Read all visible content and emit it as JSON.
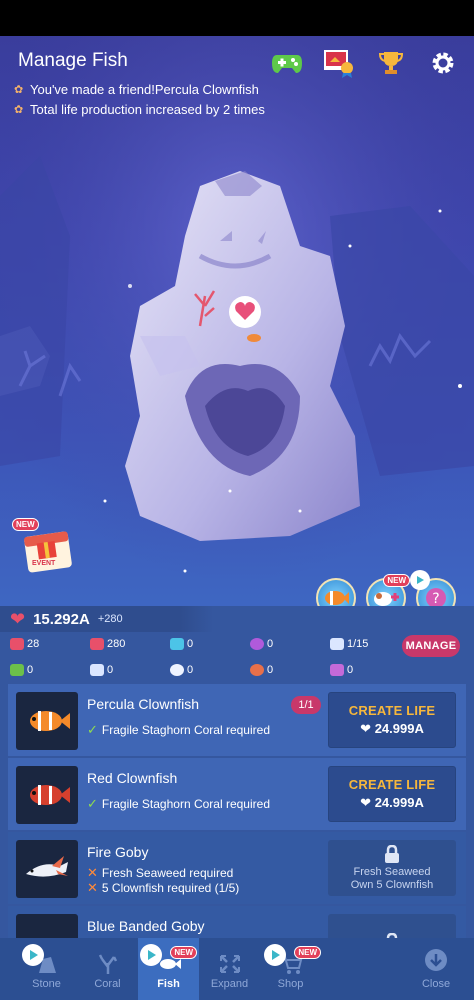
{
  "header": {
    "title": "Manage Fish",
    "messages": [
      "You've made a friend!Percula Clownfish",
      "Total life production increased by 2 times"
    ]
  },
  "icons": {
    "controller": "game-controller-icon",
    "album": "photo-album-icon",
    "trophy": "trophy-icon",
    "settings": "gear-icon"
  },
  "event": {
    "new": "NEW",
    "label": "EVENT"
  },
  "actions": {
    "new": "NEW"
  },
  "life": {
    "value": "15.292A",
    "rate": "+280"
  },
  "stats_row1": [
    {
      "icon": "heart-icon",
      "value": "28"
    },
    {
      "icon": "heart-icon",
      "value": "280"
    },
    {
      "icon": "diamond-icon",
      "value": "0"
    },
    {
      "icon": "pearl-icon",
      "value": "0"
    },
    {
      "icon": "fish-icon",
      "value": "1/15"
    }
  ],
  "manage_label": "MANAGE",
  "stats_row2": [
    {
      "icon": "seaweed-icon",
      "value": "0"
    },
    {
      "icon": "shell-icon",
      "value": "0"
    },
    {
      "icon": "urchin-icon",
      "value": "0"
    },
    {
      "icon": "crab-icon",
      "value": "0"
    },
    {
      "icon": "seahorse-icon",
      "value": "0"
    }
  ],
  "fish": [
    {
      "name": "Percula Clownfish",
      "badge": "1/1",
      "req1": "Fragile Staghorn Coral required",
      "button": "CREATE LIFE",
      "cost": "24.999A"
    },
    {
      "name": "Red Clownfish",
      "req1": "Fragile Staghorn Coral required",
      "button": "CREATE LIFE",
      "cost": "24.999A"
    },
    {
      "name": "Fire Goby",
      "req1": "Fresh Seaweed required",
      "req2": "5 Clownfish required (1/5)",
      "lock1": "Fresh Seaweed",
      "lock2": "Own 5 Clownfish"
    },
    {
      "name": "Blue Banded Goby"
    }
  ],
  "nav": {
    "stone": "Stone",
    "coral": "Coral",
    "fish": "Fish",
    "expand": "Expand",
    "shop": "Shop",
    "close": "Close",
    "new": "NEW"
  },
  "colors": {
    "accent_pink": "#c8386a",
    "gold": "#f6b73c",
    "panel_blue": "#35579f"
  }
}
